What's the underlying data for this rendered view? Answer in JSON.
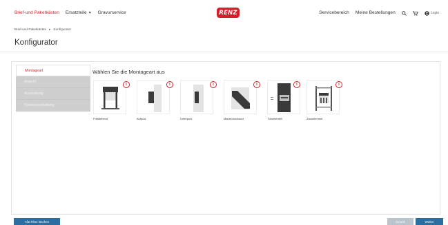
{
  "nav": {
    "links": [
      "Brief-und Paketkästen",
      "Ersatzteile",
      "Gravurservice"
    ],
    "brand": "RENZ",
    "right_links": [
      "Servicebereich",
      "Meine Bestellungen"
    ],
    "login": "Login"
  },
  "breadcrumb": [
    "Brief-und Paketkästen",
    "Konfigurator"
  ],
  "page_title": "Konfigurator",
  "sidebar": {
    "items": [
      "Montageart",
      "Ansicht",
      "Ausstattung",
      "Sonderausstattung"
    ]
  },
  "content": {
    "title": "Wählen Sie die Montageart aus",
    "options": [
      "Freistehend",
      "Aufputz",
      "Unterputz",
      "Mauerdurchwurf",
      "Türseitenteil",
      "Zaunelement"
    ],
    "info_glyph": "i"
  },
  "buttons": {
    "reset": "Alle Filter löschen",
    "back": "Zurück",
    "next": "Weiter"
  },
  "colors": {
    "accent": "#d3202c",
    "primary_button": "#2c6e9f",
    "disabled_button": "#b9c4cd"
  }
}
